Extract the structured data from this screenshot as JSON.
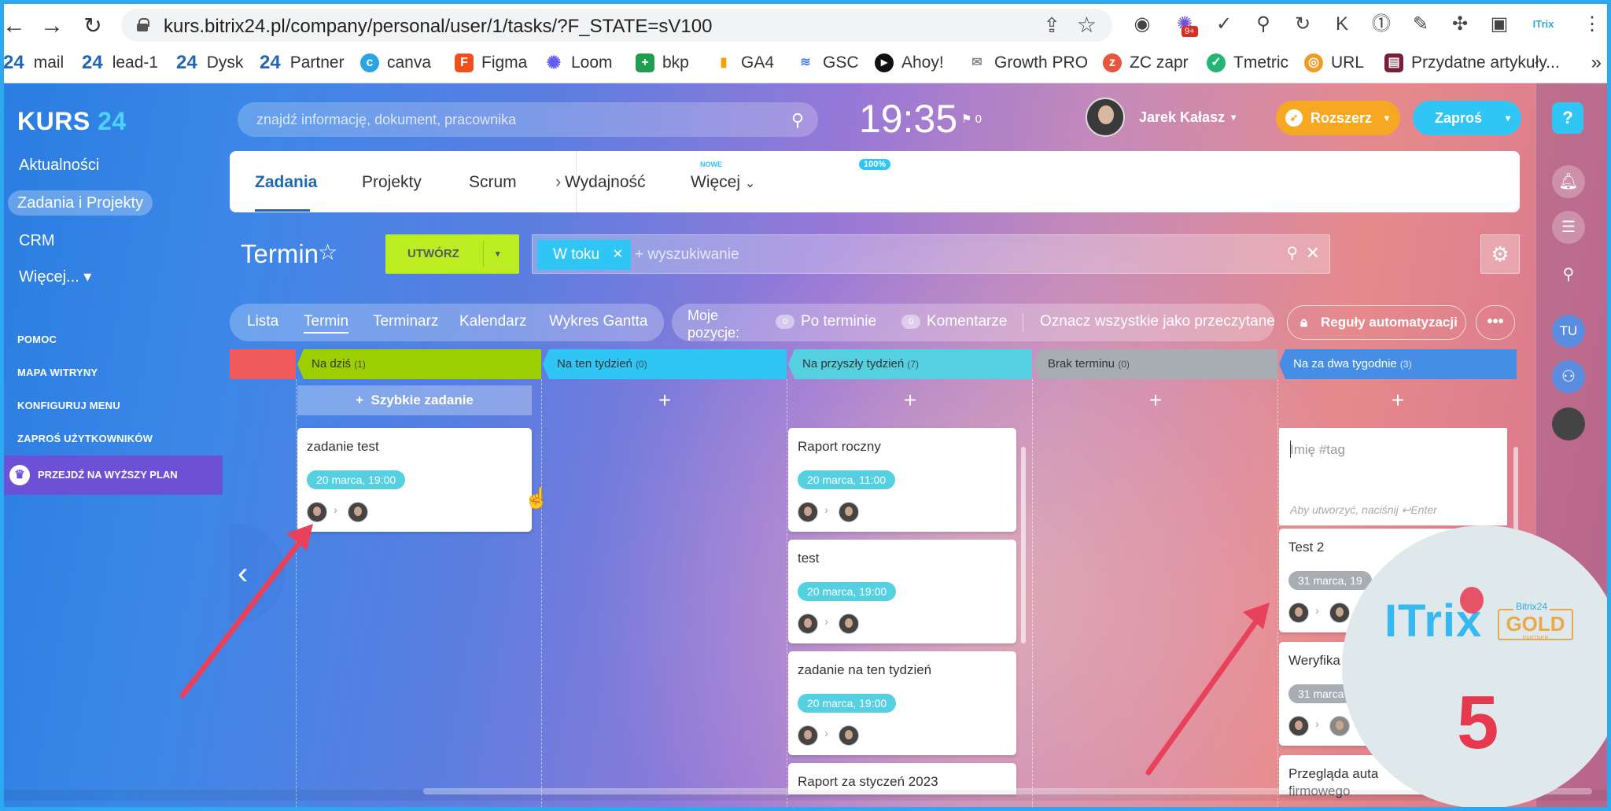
{
  "browser": {
    "url": "kurs.bitrix24.pl/company/personal/user/1/tasks/?F_STATE=sV100",
    "extensions": [
      "circle-ext",
      "9+",
      "check",
      "person",
      "refresh",
      "K",
      "1",
      "pen",
      "puzzle",
      "window",
      "ITrix",
      "more"
    ],
    "ext_badge": "9+",
    "bookmarks": [
      {
        "icon": "24",
        "label": "mail"
      },
      {
        "icon": "24",
        "label": "lead-1"
      },
      {
        "icon": "24",
        "label": "Dysk"
      },
      {
        "icon": "24",
        "label": "Partner"
      },
      {
        "icon": "canva",
        "label": "canva"
      },
      {
        "icon": "figma",
        "label": "Figma"
      },
      {
        "icon": "loom",
        "label": "Loom"
      },
      {
        "icon": "sheets",
        "label": "bkp"
      },
      {
        "icon": "ga",
        "label": "GA4"
      },
      {
        "icon": "gsc",
        "label": "GSC"
      },
      {
        "icon": "ahoy",
        "label": "Ahoy!"
      },
      {
        "icon": "mail",
        "label": "Growth PRO"
      },
      {
        "icon": "zc",
        "label": "ZC zapr"
      },
      {
        "icon": "tmetric",
        "label": "Tmetric"
      },
      {
        "icon": "url",
        "label": "URL"
      },
      {
        "icon": "doc",
        "label": "Przydatne artykuły..."
      }
    ],
    "bookmarks_more": "»"
  },
  "app": {
    "logo_text": "KURS",
    "logo_num": "24",
    "menu": [
      "Aktualności",
      "Zadania i Projekty",
      "CRM",
      "Więcej... ▾"
    ],
    "menu_small": [
      "POMOC",
      "MAPA WITRYNY",
      "KONFIGURUJ MENU",
      "ZAPROŚ UŻYTKOWNIKÓW"
    ],
    "upgrade": "PRZEJDŹ NA WYŻSZY PLAN",
    "search_placeholder": "znajdź informację, dokument, pracownika",
    "clock": "19:35",
    "flag_count": "0",
    "user_name": "Jarek Kałasz",
    "btn_rozszerz": "Rozszerz",
    "btn_zapros": "Zaproś",
    "rail": {
      "help": "?",
      "tu": "TU"
    }
  },
  "tabs": {
    "items": [
      "Zadania",
      "Projekty",
      "Scrum",
      "Wydajność",
      "Więcej"
    ],
    "nowe": "NOWE",
    "pct": "100%"
  },
  "toolbar": {
    "title": "Termin",
    "create": "UTWÓRZ",
    "chip": "W toku",
    "filter_placeholder": "+ wyszukiwanie"
  },
  "views": [
    "Lista",
    "Termin",
    "Terminarz",
    "Kalendarz",
    "Wykres Gantta"
  ],
  "counters": {
    "moje": "Moje pozycje:",
    "po_terminie": "Po terminie",
    "po_terminie_n": "0",
    "komentarze": "Komentarze",
    "komentarze_n": "0",
    "mark_read": "Oznacz wszystkie jako przeczytane",
    "rules": "Reguły automatyzacji",
    "more": "•••"
  },
  "columns": [
    {
      "name": "Na dziś",
      "count": "(1)",
      "color": "#9dcf00"
    },
    {
      "name": "Na ten tydzień",
      "count": "(0)",
      "color": "#2fc6f6"
    },
    {
      "name": "Na przyszły tydzień",
      "count": "(7)",
      "color": "#55d0e0"
    },
    {
      "name": "Brak terminu",
      "count": "(0)",
      "color": "#a8adb4"
    },
    {
      "name": "Na za dwa tygodnie",
      "count": "(3)",
      "color": "#468ee5"
    }
  ],
  "quick_add": "Szybkie zadanie",
  "cards": {
    "c1": {
      "title": "zadanie test",
      "date": "20 marca, 19:00"
    },
    "c2": {
      "title": "Raport roczny",
      "date": "20 marca, 11:00"
    },
    "c3": {
      "title": "test",
      "date": "20 marca, 19:00"
    },
    "c4": {
      "title": "zadanie na ten tydzień",
      "date": "20 marca, 19:00"
    },
    "c5": {
      "title": "Raport za styczeń 2023"
    },
    "c6": {
      "title": "Test 2",
      "date": "31 marca, 19"
    },
    "c7": {
      "title": "Weryfika",
      "date": "31 marca"
    },
    "c8": {
      "title": "Przegląda auta",
      "title2": "firmowego"
    }
  },
  "new_task": {
    "placeholder": "Imię #tag",
    "hint": "Aby utworzyć, naciśnij ↩Enter"
  },
  "overlay": {
    "itrix": "ITrix",
    "b24": "Bitrix24",
    "gold": "GOLD",
    "partner": "PARTNER",
    "number": "5",
    "arrow_color": "#e8415b"
  }
}
